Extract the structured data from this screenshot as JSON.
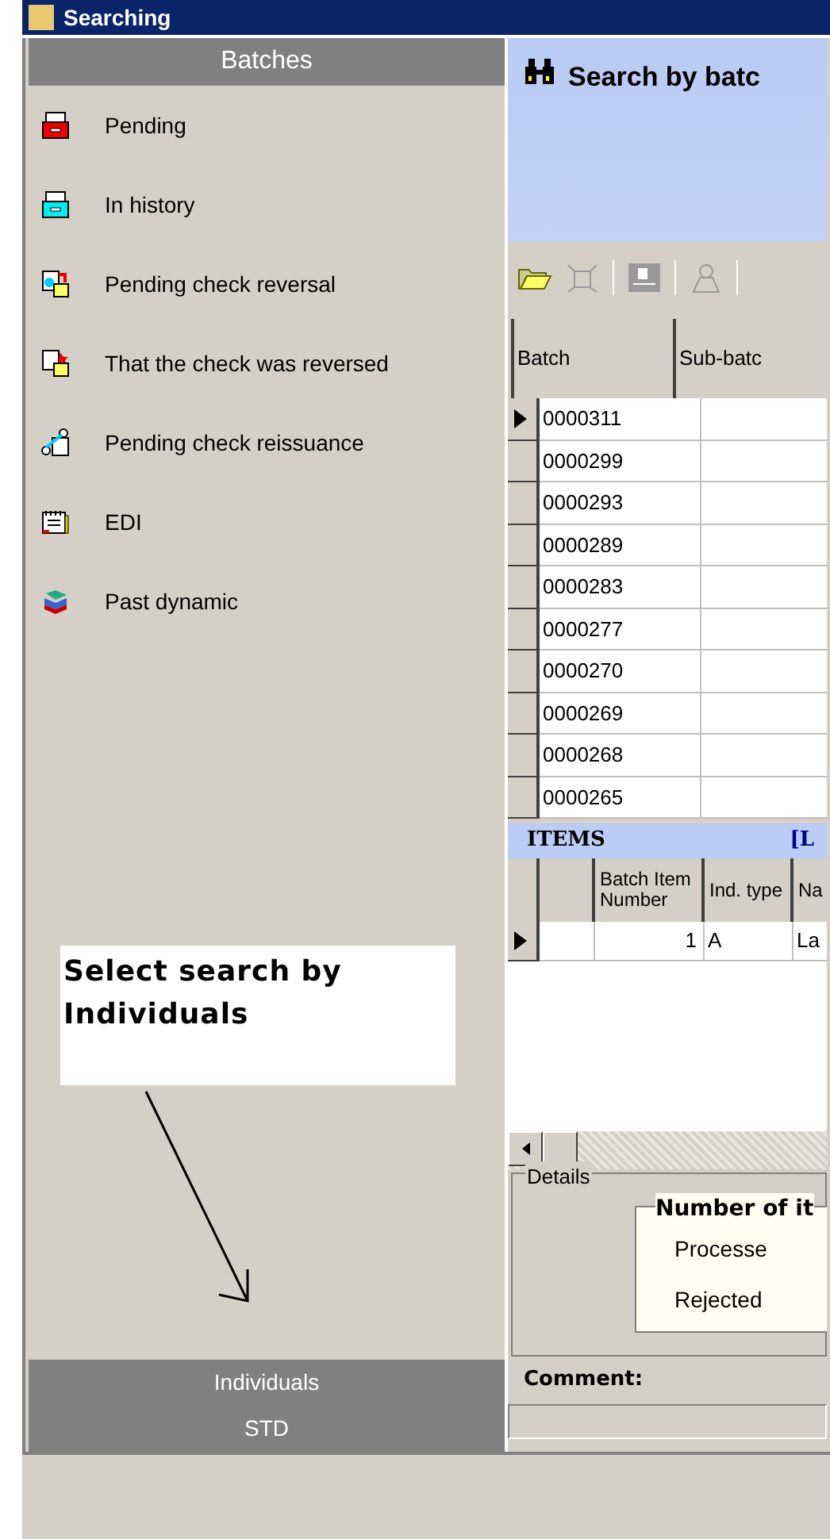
{
  "window": {
    "title": "Searching"
  },
  "sidebar": {
    "header": "Batches",
    "items": [
      {
        "label": "Pending",
        "kind": "redtray"
      },
      {
        "label": "In history",
        "kind": "cyantray"
      },
      {
        "label": "Pending check reversal",
        "kind": "reversal"
      },
      {
        "label": "That the check was reversed",
        "kind": "reversed"
      },
      {
        "label": "Pending check reissuance",
        "kind": "reissue"
      },
      {
        "label": "EDI",
        "kind": "edi"
      },
      {
        "label": "Past dynamic",
        "kind": "books"
      }
    ],
    "footer_items": [
      {
        "label": "Individuals"
      },
      {
        "label": "STD"
      }
    ]
  },
  "annotation": {
    "text": "Select search by Individuals"
  },
  "search_panel": {
    "title": "Search by batc"
  },
  "batches_table": {
    "columns": [
      "Batch",
      "Sub-batc"
    ],
    "rows": [
      {
        "batch": "0000311",
        "selected": true
      },
      {
        "batch": "0000299",
        "selected": false
      },
      {
        "batch": "0000293",
        "selected": false
      },
      {
        "batch": "0000289",
        "selected": false
      },
      {
        "batch": "0000283",
        "selected": false
      },
      {
        "batch": "0000277",
        "selected": false
      },
      {
        "batch": "0000270",
        "selected": false
      },
      {
        "batch": "0000269",
        "selected": false
      },
      {
        "batch": "0000268",
        "selected": false
      },
      {
        "batch": "0000265",
        "selected": false
      }
    ]
  },
  "items": {
    "title": "ITEMS",
    "link": "[L",
    "columns": [
      "Batch Item Number",
      "Ind. type",
      "Na"
    ],
    "rows": [
      {
        "number": "1",
        "ind_type": "A",
        "column_3": "La",
        "selected": true
      }
    ]
  },
  "details": {
    "legend": "Details",
    "group_title": "Number of it",
    "rows": [
      {
        "label": "Processe"
      },
      {
        "label": "Rejected"
      }
    ],
    "comment_label": "Comment:"
  }
}
